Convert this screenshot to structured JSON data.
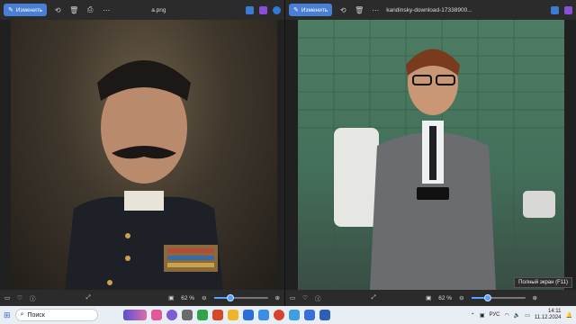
{
  "left_window": {
    "edit_label": "Изменить",
    "file_name": "a.png",
    "zoom": "62 %",
    "zoom_level": 0.3
  },
  "right_window": {
    "edit_label": "Изменить",
    "file_name": "kandinsky-download-17338900...",
    "zoom": "62 %",
    "zoom_level": 0.3,
    "tooltip": "Полный экран (F11)"
  },
  "taskbar": {
    "search_placeholder": "Поиск",
    "language": "РУС",
    "time": "14:11",
    "date": "11.12.2024"
  },
  "colors": {
    "accent": "#4a7fd6",
    "slider": "#5aa0ff",
    "taskbar": "#e9eef4"
  }
}
